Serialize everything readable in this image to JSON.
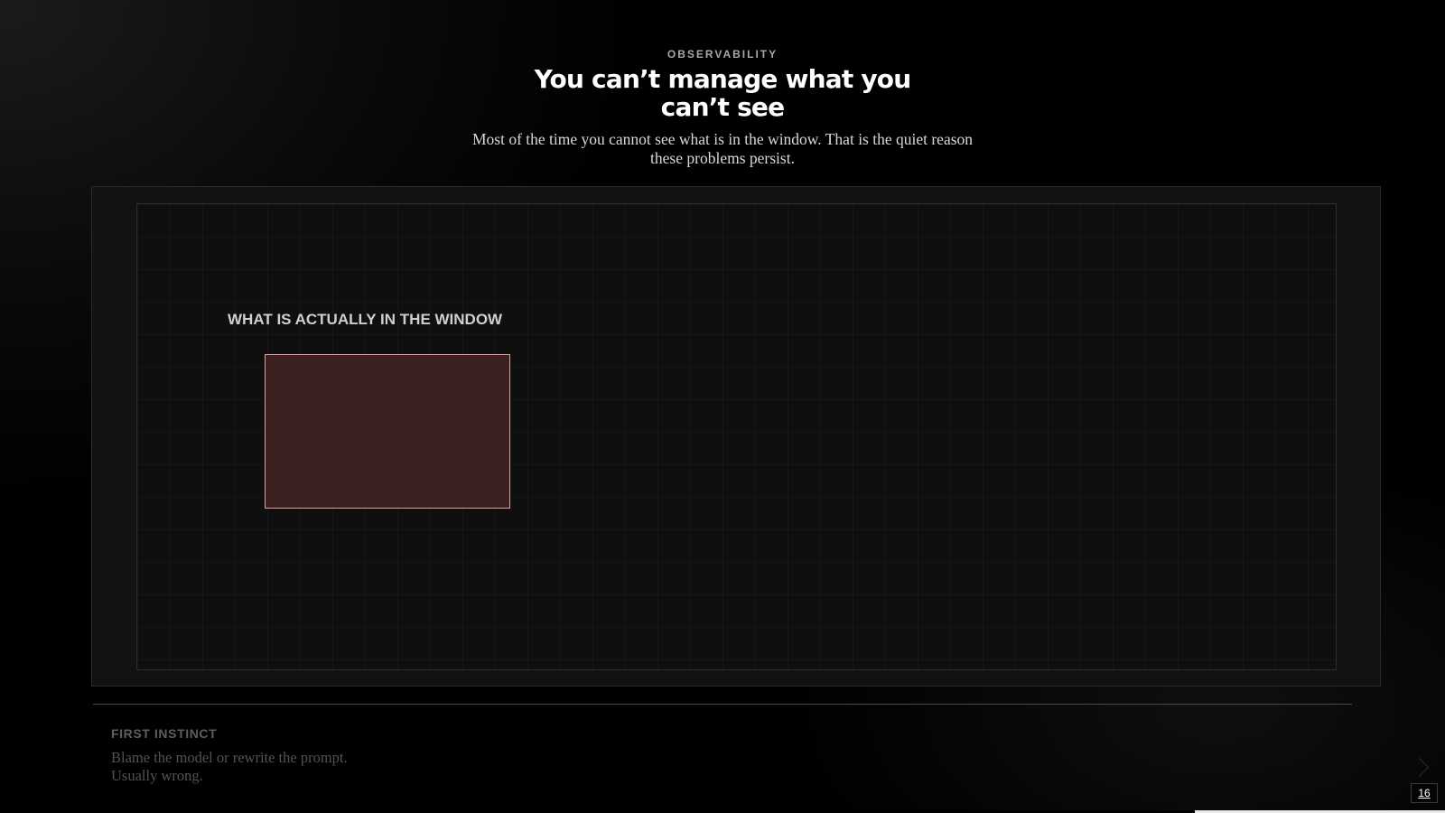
{
  "slide": {
    "eyebrow": "OBSERVABILITY",
    "title": "You can’t manage what you can’t see",
    "subtitle": "Most of the time you cannot see what is in the window. That is the quiet reason these problems persist."
  },
  "canvas": {
    "label": "WHAT IS ACTUALLY IN THE WINDOW",
    "box_fill": "#3b2020",
    "box_border": "#e0a0a0"
  },
  "first_instinct": {
    "label": "FIRST INSTINCT",
    "line1": "Blame the model or rewrite the prompt.",
    "line2": "Usually wrong."
  },
  "navigation": {
    "page_number": "16",
    "next_icon": "chevron-right-icon",
    "progress_fraction": 0.827
  },
  "colors": {
    "background": "#000000",
    "panel": "#121212",
    "accent_border": "#e0a0a0"
  }
}
